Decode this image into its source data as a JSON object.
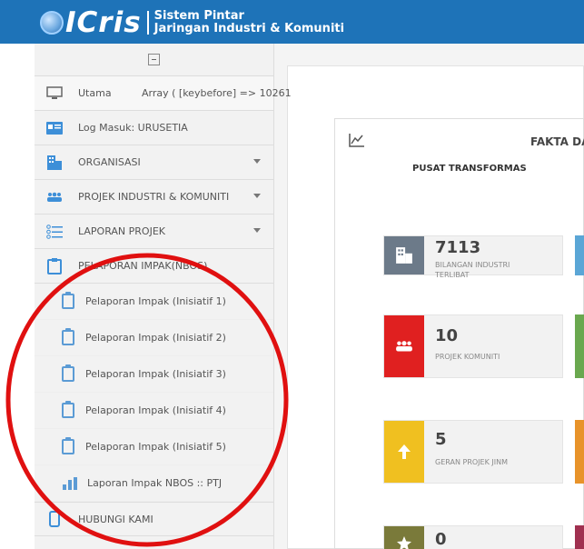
{
  "header": {
    "logo_text": "ICris",
    "subtitle_line1": "Sistem Pintar",
    "subtitle_line2": "Jaringan Industri & Komuniti",
    "bg_color": "#1e73b8"
  },
  "sidebar": {
    "items": [
      {
        "label": "Utama",
        "icon": "monitor-icon",
        "has_caret": false
      },
      {
        "label": "Log Masuk: URUSETIA",
        "icon": "id-card-icon",
        "has_caret": false
      },
      {
        "label": "ORGANISASI",
        "icon": "building-icon",
        "has_caret": true
      },
      {
        "label": "PROJEK INDUSTRI & KOMUNITI",
        "icon": "users-icon",
        "has_caret": true
      },
      {
        "label": "LAPORAN PROJEK",
        "icon": "list-icon",
        "has_caret": true
      },
      {
        "label": "PELAPORAN IMPAK(NBOS)",
        "icon": "clipboard-icon",
        "has_caret": false
      }
    ],
    "sub_items": [
      {
        "label": "Pelaporan Impak (Inisiatif 1)"
      },
      {
        "label": "Pelaporan Impak (Inisiatif 2)"
      },
      {
        "label": "Pelaporan Impak (Inisiatif 3)"
      },
      {
        "label": "Pelaporan Impak (Inisiatif 4)"
      },
      {
        "label": "Pelaporan Impak (Inisiatif 5)"
      },
      {
        "label": "Laporan Impak NBOS :: PTJ"
      }
    ],
    "bottom_item": {
      "label": "HUBUNGI KAMI",
      "icon": "phone-icon"
    }
  },
  "main": {
    "array_text": "Array ( [keybefore] => 10261",
    "card_title": "FAKTA DA",
    "card_subtitle": "PUSAT TRANSFORMAS",
    "tiles": [
      {
        "value": "7113",
        "label": "BILANGAN INDUSTRI TERLIBAT",
        "color": "#6c7a89",
        "icon": "building-icon",
        "peek_color": "#5ba6d6"
      },
      {
        "value": "10",
        "label": "PROJEK KOMUNITI",
        "color": "#e02020",
        "icon": "users-icon",
        "peek_color": "#6aa84f"
      },
      {
        "value": "5",
        "label": "GERAN PROJEK JINM",
        "color": "#f0c020",
        "icon": "arrow-up-icon",
        "peek_color": "#e8932a"
      },
      {
        "value": "0",
        "label": "",
        "color": "#7a7a3a",
        "icon": "star-icon",
        "peek_color": "#a03050"
      }
    ]
  },
  "annotation": {
    "color": "#e01010"
  }
}
